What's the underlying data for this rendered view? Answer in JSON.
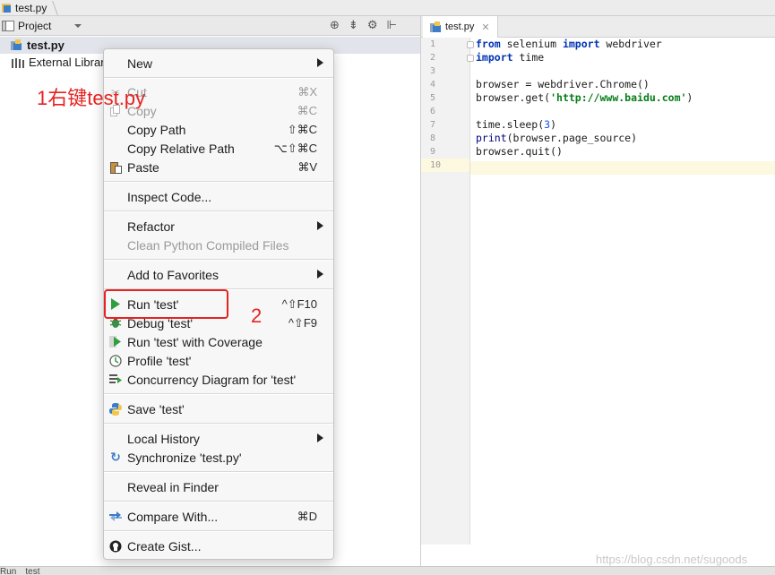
{
  "breadcrumb": {
    "file": "test.py"
  },
  "project_panel": {
    "title": "Project",
    "tree": [
      {
        "label": "test.py"
      },
      {
        "label": "External Libraries"
      }
    ]
  },
  "editor": {
    "tab_label": "test.py",
    "line_numbers": [
      "1",
      "2",
      "3",
      "4",
      "5",
      "6",
      "7",
      "8",
      "9",
      "10"
    ],
    "current_line": 10
  },
  "context_menu": {
    "new": {
      "label": "New"
    },
    "cut": {
      "label": "Cut",
      "shortcut": "⌘X"
    },
    "copy": {
      "label": "Copy",
      "shortcut": "⌘C"
    },
    "copy_path": {
      "label": "Copy Path",
      "shortcut": "⇧⌘C"
    },
    "copy_relative_path": {
      "label": "Copy Relative Path",
      "shortcut": "⌥⇧⌘C"
    },
    "paste": {
      "label": "Paste",
      "shortcut": "⌘V"
    },
    "inspect_code": {
      "label": "Inspect Code..."
    },
    "refactor": {
      "label": "Refactor"
    },
    "clean_compiled": {
      "label": "Clean Python Compiled Files"
    },
    "add_to_favorites": {
      "label": "Add to Favorites"
    },
    "run": {
      "label": "Run 'test'",
      "shortcut": "^⇧F10"
    },
    "debug": {
      "label": "Debug 'test'",
      "shortcut": "^⇧F9"
    },
    "run_coverage": {
      "label": "Run 'test' with Coverage"
    },
    "profile": {
      "label": "Profile 'test'"
    },
    "concurrency": {
      "label": "Concurrency Diagram for 'test'"
    },
    "save": {
      "label": "Save 'test'"
    },
    "local_history": {
      "label": "Local History"
    },
    "synchronize": {
      "label": "Synchronize 'test.py'"
    },
    "reveal": {
      "label": "Reveal in Finder"
    },
    "compare": {
      "label": "Compare With...",
      "shortcut": "⌘D"
    },
    "create_gist": {
      "label": "Create Gist..."
    }
  },
  "annotations": {
    "step1": "1右键test.py",
    "step2": "2"
  },
  "bottom_bar": {
    "left": "Run",
    "file": "test"
  },
  "watermark": "https://blog.csdn.net/sugoods",
  "colors": {
    "annotation_red": "#e62323",
    "run_green": "#2e9e3e",
    "keyword_blue": "#0033b3",
    "string_green": "#067d17"
  }
}
